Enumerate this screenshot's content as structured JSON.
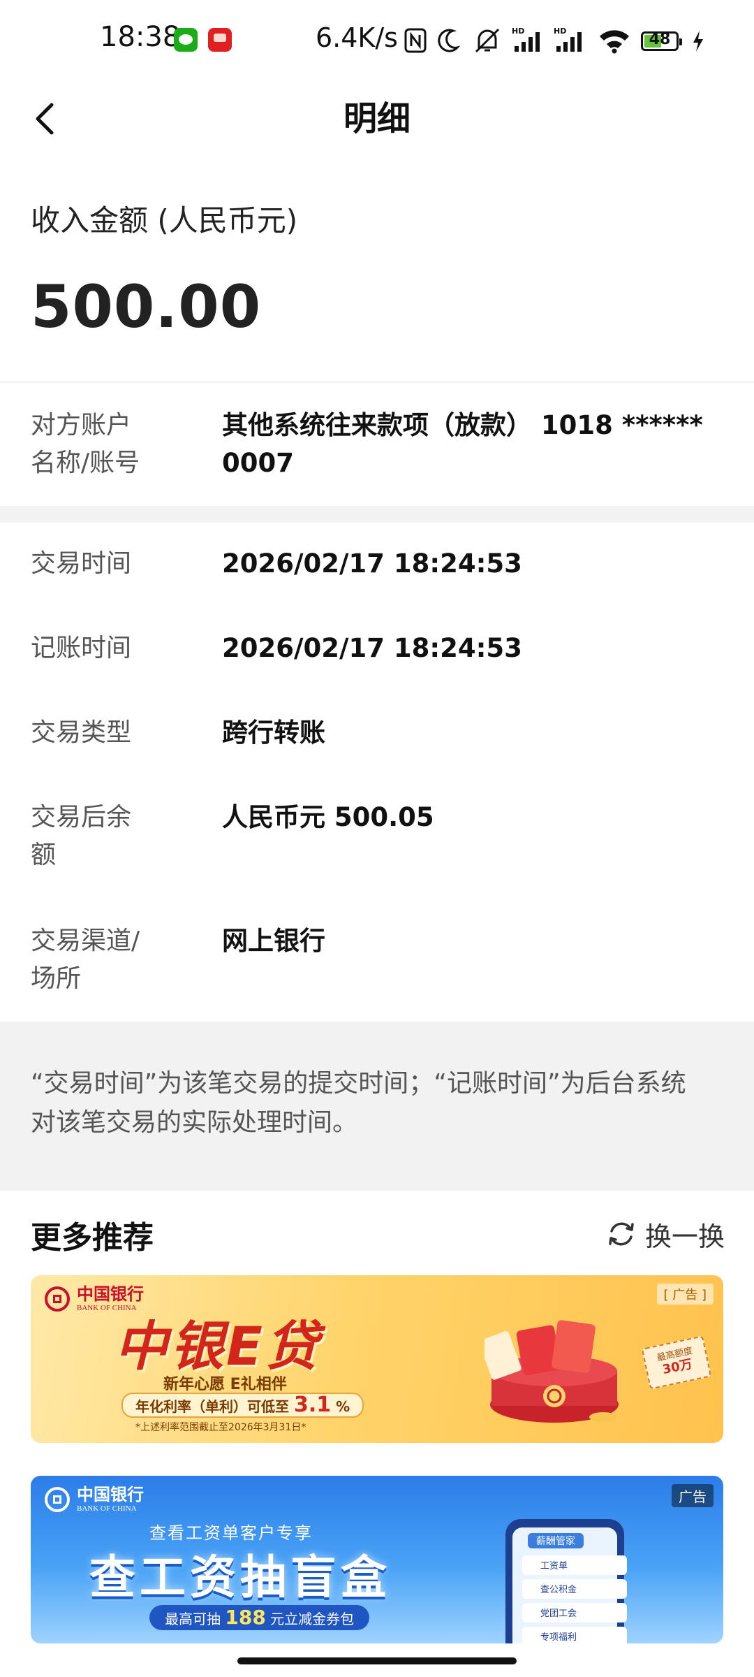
{
  "status_bar": {
    "time": "18:38",
    "network_speed": "6.4K/s",
    "battery": "48",
    "icons": [
      "wechat-icon",
      "red-app-icon",
      "nfc-icon",
      "moon-icon",
      "mute-icon",
      "hd-signal-icon",
      "hd-signal-icon",
      "wifi-icon",
      "battery-icon",
      "charging-icon"
    ]
  },
  "nav": {
    "title": "明细",
    "back_icon": "chevron-left-icon"
  },
  "amount": {
    "label": "收入金额 (人民币元)",
    "value": "500.00"
  },
  "details": {
    "counterparty": {
      "label_line1": "对方账户",
      "label_line2": "名称/账号",
      "value_line1": "其他系统往来款项（放款） 1018 ******",
      "value_line2": "0007"
    },
    "rows": [
      {
        "label_line1": "交易时间",
        "label_line2": "",
        "value": "2026/02/17 18:24:53"
      },
      {
        "label_line1": "记账时间",
        "label_line2": "",
        "value": "2026/02/17 18:24:53"
      },
      {
        "label_line1": "交易类型",
        "label_line2": "",
        "value": "跨行转账"
      },
      {
        "label_line1": "交易后余",
        "label_line2": "额",
        "value": "人民币元 500.05"
      },
      {
        "label_line1": "交易渠道/",
        "label_line2": "场所",
        "value": "网上银行"
      }
    ]
  },
  "note": {
    "line1": "“交易时间”为该笔交易的提交时间；“记账时间”为后台系统",
    "line2": "对该笔交易的实际处理时间。"
  },
  "recommend": {
    "title": "更多推荐",
    "refresh_label": "换一换",
    "banners": [
      {
        "bank_cn": "中国银行",
        "bank_en": "BANK OF CHINA",
        "ad_tag": "[ 广告 ]",
        "headline": "中银E贷",
        "sub": "新年心愿 E礼相伴",
        "rate_prefix": "年化利率（单利）可低至",
        "rate_value": "3.1",
        "rate_unit": "%",
        "footnote": "*上述利率范围截止至2026年3月31日*",
        "ticket_line1": "最高额度",
        "ticket_line2": "30万"
      },
      {
        "bank_cn": "中国银行",
        "bank_en": "BANK OF CHINA",
        "ad_tag": "广告",
        "top_line": "查看工资单客户专享",
        "headline": "查工资抽盲盒",
        "pill_prefix": "最高可抽",
        "pill_value": "188",
        "pill_suffix": "元立减金券包",
        "phone_title": "薪酬管家",
        "phone_items": [
          "工资单",
          "查公积金",
          "党团工会",
          "专项福利"
        ]
      }
    ]
  }
}
